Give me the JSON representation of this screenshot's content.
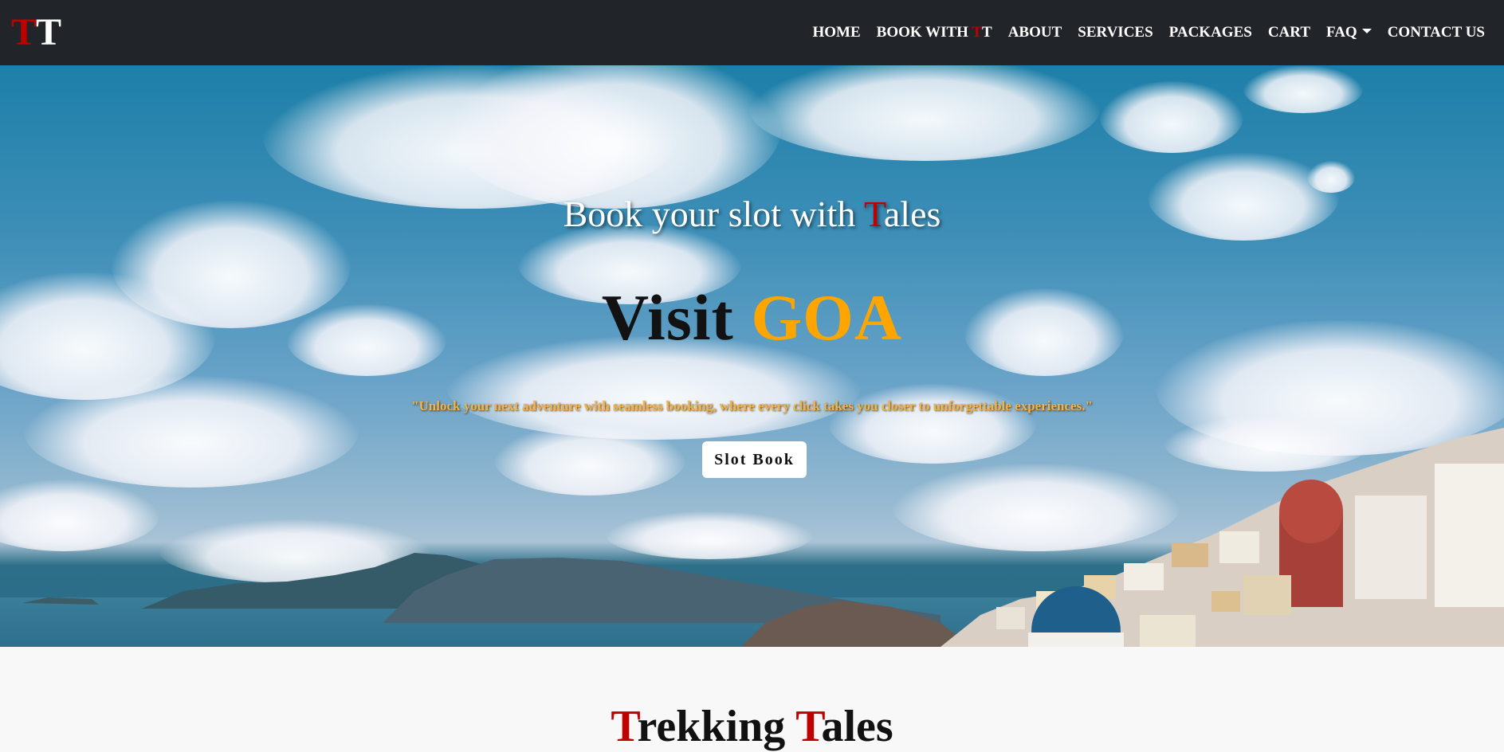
{
  "brand": {
    "letter1": "T",
    "letter2": "T"
  },
  "nav": {
    "home": "HOME",
    "book_prefix": "BOOK WITH ",
    "book_t1": "T",
    "book_t2": "T",
    "about": "ABOUT",
    "services": "SERVICES",
    "packages": "PACKAGES",
    "cart": "CART",
    "faq": "FAQ",
    "contact": "CONTACT US"
  },
  "hero": {
    "subtitle_prefix": "Book your slot with ",
    "subtitle_T": "T",
    "subtitle_rest": "ales",
    "title_word": "Visit",
    "title_place": "GOA",
    "quote": "\"Unlock your next adventure with seamless booking, where every click takes you closer to unforgettable experiences.\"",
    "button_label": "Slot Book"
  },
  "section": {
    "heading_p1": "T",
    "heading_p2": "rekking ",
    "heading_p3": "T",
    "heading_p4": "ales"
  },
  "colors": {
    "navbar_bg": "#212529",
    "brand_red": "#c00000",
    "accent_gold": "#ffa500",
    "quote_gold": "#f3b24a"
  },
  "icons": {
    "faq_dropdown": "caret-down-icon"
  }
}
